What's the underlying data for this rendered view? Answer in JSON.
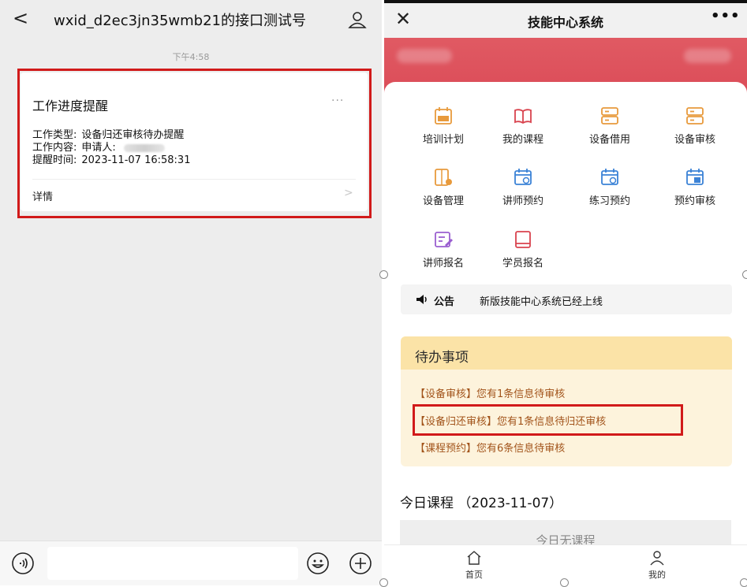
{
  "chat": {
    "back_glyph": "<",
    "title": "wxid_d2ec3jn35wmb21的接口测试号",
    "time": "下午4:58",
    "card": {
      "title": "工作进度提醒",
      "more": "···",
      "type_label": "工作类型:",
      "type_value": "设备归还审核待办提醒",
      "content_label": "工作内容:",
      "content_value": "申请人:",
      "time_label": "提醒时间:",
      "time_value": "2023-11-07 16:58:31",
      "detail": "详情",
      "arrow": ">"
    },
    "icons": {
      "back": "chevron-left-icon",
      "profile": "person-icon",
      "voice": "voice-icon",
      "emoji": "smile-icon",
      "add": "plus-icon"
    }
  },
  "app": {
    "close_glyph": "✕",
    "title": "技能中心系统",
    "more_glyph": "•••",
    "accent": "#db4b57",
    "menu": [
      {
        "label": "培训计划",
        "icon": "training-plan-icon"
      },
      {
        "label": "我的课程",
        "icon": "book-icon"
      },
      {
        "label": "设备借用",
        "icon": "device-borrow-icon"
      },
      {
        "label": "设备审核",
        "icon": "device-review-icon"
      },
      {
        "label": "设备管理",
        "icon": "device-manage-icon"
      },
      {
        "label": "讲师预约",
        "icon": "calendar-icon"
      },
      {
        "label": "练习预约",
        "icon": "calendar-icon"
      },
      {
        "label": "预约审核",
        "icon": "calendar-review-icon"
      },
      {
        "label": "讲师报名",
        "icon": "edit-form-icon"
      },
      {
        "label": "学员报名",
        "icon": "book-icon"
      }
    ],
    "notice": {
      "tag": "公告",
      "text": "新版技能中心系统已经上线"
    },
    "todo": {
      "title": "待办事项",
      "items": [
        "【设备审核】您有1条信息待审核",
        "【设备归还审核】您有1条信息待归还审核",
        "【课程预约】您有6条信息待审核"
      ]
    },
    "today": {
      "title": "今日课程 （2023-11-07）",
      "empty": "今日无课程"
    },
    "tabs": [
      {
        "label": "首页",
        "icon": "home-icon"
      },
      {
        "label": "我的",
        "icon": "user-icon"
      }
    ]
  }
}
